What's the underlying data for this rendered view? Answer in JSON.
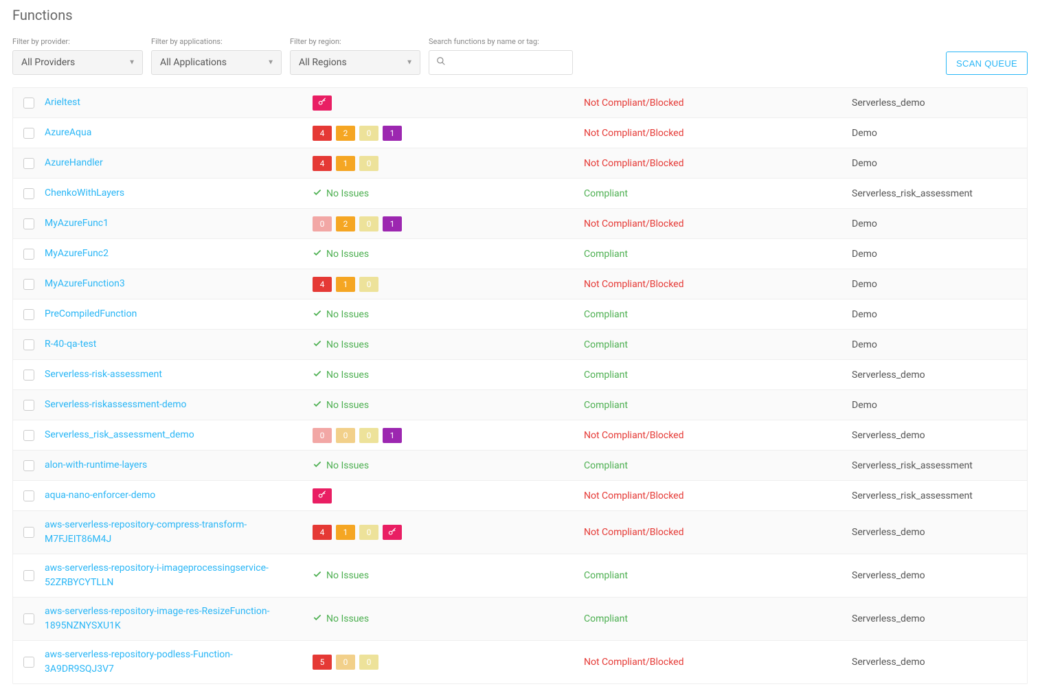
{
  "title": "Functions",
  "filters": {
    "provider_label": "Filter by provider:",
    "provider_value": "All Providers",
    "apps_label": "Filter by applications:",
    "apps_value": "All Applications",
    "region_label": "Filter by region:",
    "region_value": "All Regions",
    "search_label": "Search functions by name or tag:",
    "search_placeholder": ""
  },
  "scan_button": "SCAN QUEUE",
  "status_labels": {
    "not_compliant": "Not Compliant/Blocked",
    "compliant": "Compliant"
  },
  "no_issues_label": "No Issues",
  "rows": [
    {
      "name": "Arieltest",
      "risk": {
        "type": "key"
      },
      "status": "nc",
      "app": "Serverless_demo"
    },
    {
      "name": "AzureAqua",
      "risk": {
        "type": "badges",
        "items": [
          {
            "v": "4",
            "c": "b-crit"
          },
          {
            "v": "2",
            "c": "b-high"
          },
          {
            "v": "0",
            "c": "b-med"
          },
          {
            "v": "1",
            "c": "b-low"
          }
        ]
      },
      "status": "nc",
      "app": "Demo"
    },
    {
      "name": "AzureHandler",
      "risk": {
        "type": "badges",
        "items": [
          {
            "v": "4",
            "c": "b-crit"
          },
          {
            "v": "1",
            "c": "b-high"
          },
          {
            "v": "0",
            "c": "b-med"
          }
        ]
      },
      "status": "nc",
      "app": "Demo"
    },
    {
      "name": "ChenkoWithLayers",
      "risk": {
        "type": "none"
      },
      "status": "c",
      "app": "Serverless_risk_assessment"
    },
    {
      "name": "MyAzureFunc1",
      "risk": {
        "type": "badges",
        "items": [
          {
            "v": "0",
            "c": "b-crit-muted"
          },
          {
            "v": "2",
            "c": "b-high"
          },
          {
            "v": "0",
            "c": "b-med"
          },
          {
            "v": "1",
            "c": "b-low"
          }
        ]
      },
      "status": "nc",
      "app": "Demo"
    },
    {
      "name": "MyAzureFunc2",
      "risk": {
        "type": "none"
      },
      "status": "c",
      "app": "Demo"
    },
    {
      "name": "MyAzureFunction3",
      "risk": {
        "type": "badges",
        "items": [
          {
            "v": "4",
            "c": "b-crit"
          },
          {
            "v": "1",
            "c": "b-high"
          },
          {
            "v": "0",
            "c": "b-med"
          }
        ]
      },
      "status": "nc",
      "app": "Demo"
    },
    {
      "name": "PreCompiledFunction",
      "risk": {
        "type": "none"
      },
      "status": "c",
      "app": "Demo"
    },
    {
      "name": "R-40-qa-test",
      "risk": {
        "type": "none"
      },
      "status": "c",
      "app": "Demo"
    },
    {
      "name": "Serverless-risk-assessment",
      "risk": {
        "type": "none"
      },
      "status": "c",
      "app": "Serverless_demo"
    },
    {
      "name": "Serverless-riskassessment-demo",
      "risk": {
        "type": "none"
      },
      "status": "c",
      "app": "Demo"
    },
    {
      "name": "Serverless_risk_assessment_demo",
      "risk": {
        "type": "badges",
        "items": [
          {
            "v": "0",
            "c": "b-crit-muted"
          },
          {
            "v": "0",
            "c": "b-high-muted"
          },
          {
            "v": "0",
            "c": "b-med"
          },
          {
            "v": "1",
            "c": "b-low"
          }
        ]
      },
      "status": "nc",
      "app": "Serverless_demo"
    },
    {
      "name": "alon-with-runtime-layers",
      "risk": {
        "type": "none"
      },
      "status": "c",
      "app": "Serverless_risk_assessment"
    },
    {
      "name": "aqua-nano-enforcer-demo",
      "risk": {
        "type": "key"
      },
      "status": "nc",
      "app": "Serverless_risk_assessment"
    },
    {
      "name": "aws-serverless-repository-compress-transform-M7FJEIT86M4J",
      "risk": {
        "type": "badges_key",
        "items": [
          {
            "v": "4",
            "c": "b-crit"
          },
          {
            "v": "1",
            "c": "b-high"
          },
          {
            "v": "0",
            "c": "b-med"
          }
        ]
      },
      "status": "nc",
      "app": "Serverless_demo"
    },
    {
      "name": "aws-serverless-repository-i-imageprocessingservice-52ZRBYCYTLLN",
      "risk": {
        "type": "none"
      },
      "status": "c",
      "app": "Serverless_demo"
    },
    {
      "name": "aws-serverless-repository-image-res-ResizeFunction-1895NZNYSXU1K",
      "risk": {
        "type": "none"
      },
      "status": "c",
      "app": "Serverless_demo"
    },
    {
      "name": "aws-serverless-repository-podless-Function-3A9DR9SQJ3V7",
      "risk": {
        "type": "badges",
        "items": [
          {
            "v": "5",
            "c": "b-crit"
          },
          {
            "v": "0",
            "c": "b-high-muted"
          },
          {
            "v": "0",
            "c": "b-med"
          }
        ]
      },
      "status": "nc",
      "app": "Serverless_demo"
    }
  ]
}
